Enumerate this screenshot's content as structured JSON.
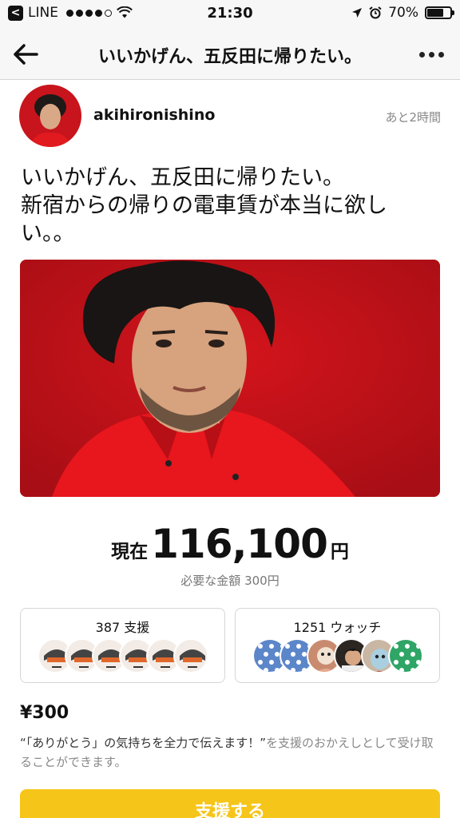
{
  "status_bar": {
    "carrier": "LINE",
    "time": "21:30",
    "battery": "70%",
    "battery_level": 0.7
  },
  "nav": {
    "title": "いいかげん、五反田に帰りたい。"
  },
  "post": {
    "username": "akihironishino",
    "time_left": "あと2時間",
    "message_lines": [
      "いいかげん、五反田に帰りたい。",
      "新宿からの帰りの電車賃が本当に欲し",
      "い。。"
    ]
  },
  "funding": {
    "current_prefix": "現在",
    "current_amount": "116,100",
    "current_unit": "円",
    "required": "必要な金額 300円"
  },
  "stats": {
    "support_label": "387 支援",
    "watch_label": "1251 ウォッチ"
  },
  "reward": {
    "price": "¥300",
    "desc_strong": "“「ありがとう」の気持ちを全力で伝えます！”",
    "desc_rest": "を支援のおかえしとして受け取ることができます。"
  },
  "cta": {
    "label": "支援する"
  },
  "colors": {
    "accent": "#f6c519",
    "hero_bg": "#c8141c"
  }
}
